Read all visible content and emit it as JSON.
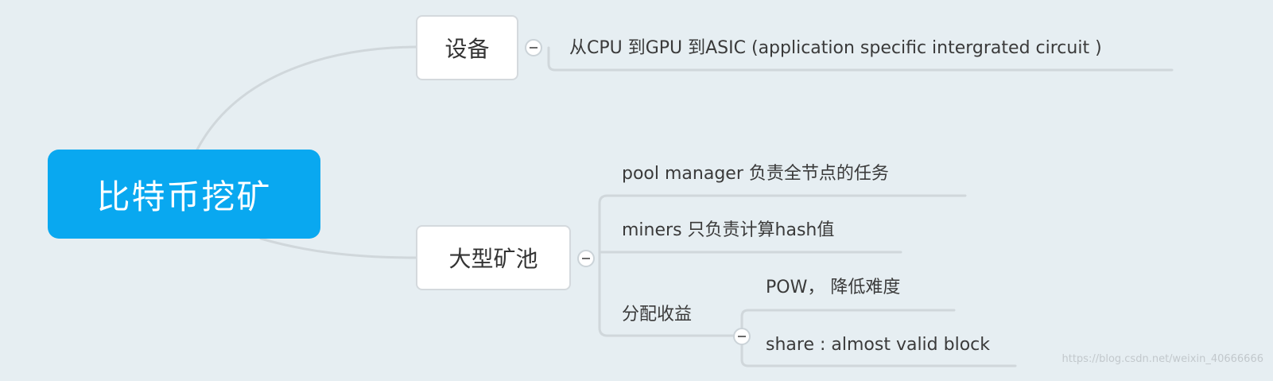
{
  "root": {
    "label": "比特币挖矿"
  },
  "branches": [
    {
      "label": "设备",
      "children": [
        {
          "label": "从CPU 到GPU 到ASIC (application specific intergrated circuit )"
        }
      ]
    },
    {
      "label": "大型矿池",
      "children": [
        {
          "label": "pool manager 负责全节点的任务"
        },
        {
          "label": "miners 只负责计算hash值"
        },
        {
          "label": "分配收益",
          "children": [
            {
              "label": "POW， 降低难度"
            },
            {
              "label": "share : almost valid block"
            }
          ]
        }
      ]
    }
  ],
  "watermark": "https://blog.csdn.net/weixin_40666666",
  "colors": {
    "root": "#09a8f0",
    "background": "#e6eef2",
    "connector": "#d2d9dd"
  }
}
